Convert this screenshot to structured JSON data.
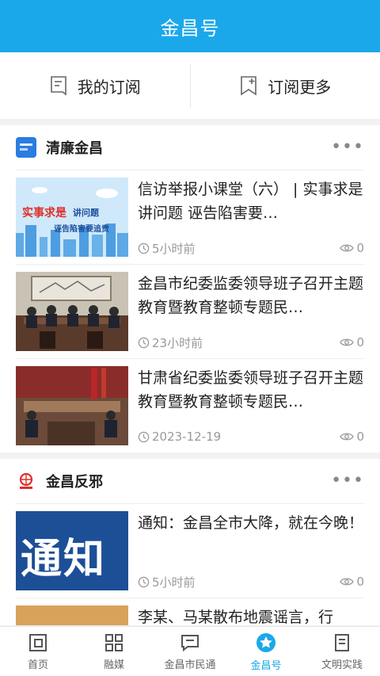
{
  "header": {
    "title": "金昌号"
  },
  "subbar": {
    "my_subscriptions": "我的订阅",
    "subscribe_more": "订阅更多"
  },
  "sections": [
    {
      "name": "清廉金昌",
      "items": [
        {
          "title": "信访举报小课堂（六） | 实事求是讲问题  诬告陷害要…",
          "time": "5小时前",
          "views": "0"
        },
        {
          "title": "金昌市纪委监委领导班子召开主题教育暨教育整顿专题民…",
          "time": "23小时前",
          "views": "0"
        },
        {
          "title": "甘肃省纪委监委领导班子召开主题教育暨教育整顿专题民…",
          "time": "2023-12-19",
          "views": "0"
        }
      ]
    },
    {
      "name": "金昌反邪",
      "items": [
        {
          "title": "通知：金昌全市大降，就在今晚！",
          "time": "5小时前",
          "views": "0"
        },
        {
          "title": "李某、马某散布地震谣言，行",
          "time": "",
          "views": ""
        }
      ]
    }
  ],
  "thumbs": {
    "t1": {
      "red": "实事求是",
      "blue": "讲问题",
      "bottom": "诬告陷害要追责"
    },
    "t4": {
      "text": "通知"
    }
  },
  "tabs": [
    {
      "label": "首页"
    },
    {
      "label": "融媒"
    },
    {
      "label": "金昌市民通"
    },
    {
      "label": "金昌号"
    },
    {
      "label": "文明实践"
    }
  ],
  "colors": {
    "brand": "#1ba8ea",
    "section_logo_1": "#2a7de1"
  }
}
